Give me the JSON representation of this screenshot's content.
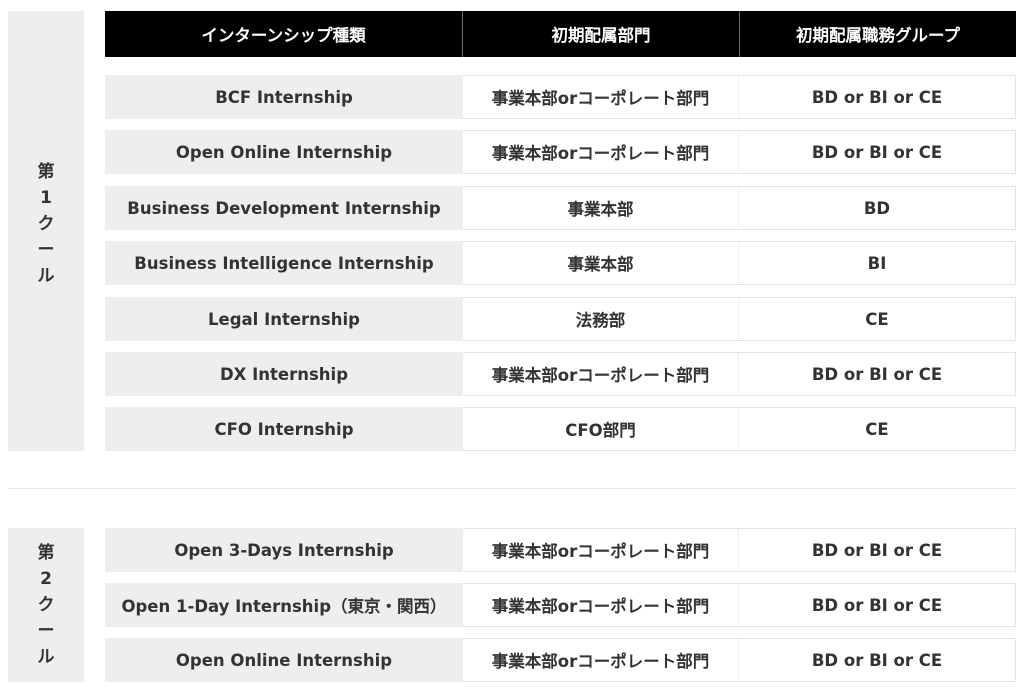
{
  "header": {
    "col1": "インターンシップ種類",
    "col2": "初期配属部門",
    "col3": "初期配属職務グループ"
  },
  "cools": [
    {
      "label_chars": [
        "第",
        "1",
        "ク",
        "ー",
        "ル"
      ],
      "rows": [
        {
          "type": "BCF Internship",
          "dept": "事業本部orコーポレート部門",
          "group": "BD or BI or CE"
        },
        {
          "type": "Open Online Internship",
          "dept": "事業本部orコーポレート部門",
          "group": "BD or BI or CE"
        },
        {
          "type": "Business Development Internship",
          "dept": "事業本部",
          "group": "BD"
        },
        {
          "type": "Business Intelligence Internship",
          "dept": "事業本部",
          "group": "BI"
        },
        {
          "type": "Legal Internship",
          "dept": "法務部",
          "group": "CE"
        },
        {
          "type": "DX Internship",
          "dept": "事業本部orコーポレート部門",
          "group": "BD or BI or CE"
        },
        {
          "type": "CFO Internship",
          "dept": "CFO部門",
          "group": "CE"
        }
      ]
    },
    {
      "label_chars": [
        "第",
        "2",
        "ク",
        "ー",
        "ル"
      ],
      "rows": [
        {
          "type": "Open 3-Days Internship",
          "dept": "事業本部orコーポレート部門",
          "group": "BD or BI or CE"
        },
        {
          "type": "Open 1-Day Internship（東京・関西）",
          "dept": "事業本部orコーポレート部門",
          "group": "BD or BI or CE"
        },
        {
          "type": "Open Online Internship",
          "dept": "事業本部orコーポレート部門",
          "group": "BD or BI or CE"
        }
      ]
    }
  ]
}
